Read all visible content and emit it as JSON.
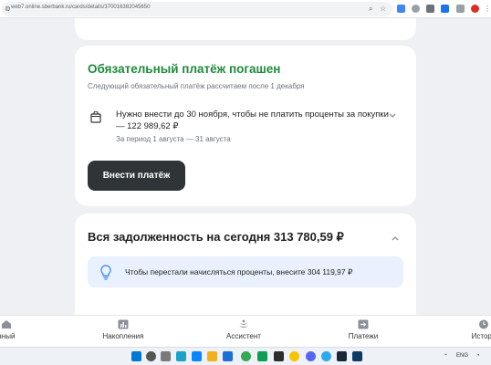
{
  "browser": {
    "url": "web7.online.sberbank.ru/cards/details/370016382045650"
  },
  "payment_card": {
    "title": "Обязательный платёж погашен",
    "subtitle": "Следующий обязательный платёж рассчитаем после 1 декабря",
    "main_text": "Нужно внести до 30 ноября, чтобы не платить проценты за покупки — 122 989,62 ₽",
    "period": "За период 1 августа — 31 августа",
    "button_label": "Внести платёж"
  },
  "debt_card": {
    "title": "Вся задолженность на сегодня 313 780,59 ₽",
    "note": "Чтобы перестали начисляться проценты, внесите 304 119,97 ₽"
  },
  "bottom_nav": {
    "items": [
      {
        "label": "вный",
        "icon": "home-icon"
      },
      {
        "label": "Накопления",
        "icon": "chart-icon"
      },
      {
        "label": "Ассистент",
        "icon": "assistant-icon"
      },
      {
        "label": "Платежи",
        "icon": "arrow-icon"
      },
      {
        "label": "Истори",
        "icon": "clock-icon"
      }
    ]
  },
  "taskbar": {
    "lang": "ENG"
  },
  "colors": {
    "accent_green": "#1f8a3b",
    "button_dark": "#2f3437",
    "note_bg": "#e8f1fd"
  }
}
